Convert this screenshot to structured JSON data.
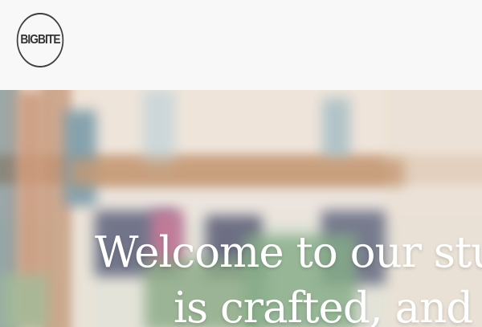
{
  "header": {
    "logo_text": "BIGBITE"
  },
  "hero": {
    "headline_line_1": "Welcome to our stu",
    "headline_line_2": "is crafted, and ic",
    "background_description": "",
    "colors": {
      "accent_wood": "#b98457",
      "foliage": "#6b9a6e",
      "signage": "#353a5c"
    }
  }
}
